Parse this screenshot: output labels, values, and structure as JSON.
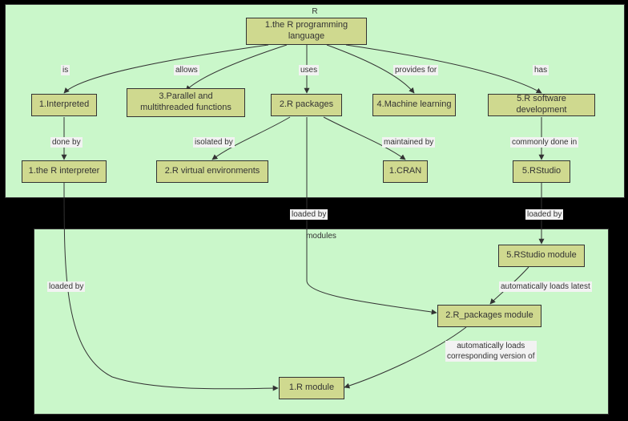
{
  "clusters": {
    "top": {
      "label": "R"
    },
    "bottom": {
      "label": "modules"
    }
  },
  "nodes": {
    "root": "1.the R programming\nlanguage",
    "interpreted": "1.Interpreted",
    "parallel": "3.Parallel and\nmultithreaded functions",
    "rpackages": "2.R packages",
    "ml": "4.Machine learning",
    "rdev": "5.R software development",
    "interpreter": "1.the R interpreter",
    "venv": "2.R virtual environments",
    "cran": "1.CRAN",
    "rstudio": "5.RStudio",
    "rstudioModule": "5.RStudio module",
    "rpackagesModule": "2.R_packages module",
    "rmodule": "1.R module"
  },
  "edges": {
    "is": "is",
    "allows": "allows",
    "uses": "uses",
    "providesFor": "provides for",
    "has": "has",
    "doneBy": "done by",
    "isolatedBy": "isolated by",
    "maintainedBy": "maintained by",
    "commonlyDoneIn": "commonly done in",
    "loadedBy1": "loaded by",
    "loadedBy2": "loaded by",
    "loadedBy3": "loaded by",
    "autoLoadsLatest": "automatically loads latest",
    "autoLoadsVersion": "automatically loads\ncorresponding version of"
  }
}
